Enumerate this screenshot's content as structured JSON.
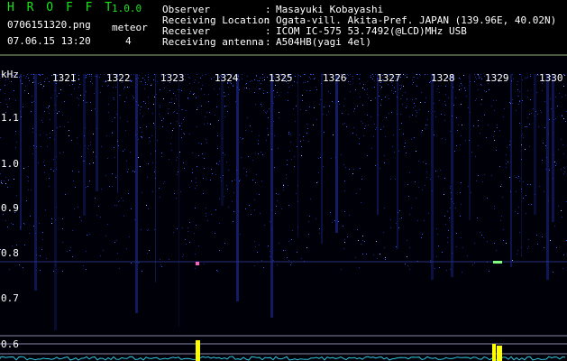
{
  "header": {
    "app_title": "H R O F F T",
    "version": "1.0.0",
    "filename": "0706151320.png",
    "datetime": "07.06.15 13:20",
    "meteor_label": "meteor",
    "meteor_count": "4"
  },
  "info": [
    {
      "label": "Observer",
      "value": "Masayuki Kobayashi"
    },
    {
      "label": "Receiving Location",
      "value": "Ogata-vill. Akita-Pref. JAPAN (139.96E, 40.02N)"
    },
    {
      "label": "Receiver",
      "value": "ICOM IC-575 53.7492(@LCD)MHz USB"
    },
    {
      "label": "Receiving antenna",
      "value": "A504HB(yagi 4el)"
    }
  ],
  "spectrogram": {
    "y_unit": "kHz",
    "y_ticks": [
      "1.1",
      "1.0",
      "0.9",
      "0.8",
      "0.7",
      "0.6"
    ],
    "time_ticks": [
      "1321",
      "1322",
      "1323",
      "1324",
      "1325",
      "1326",
      "1327",
      "1328",
      "1329",
      "1330"
    ]
  },
  "colors": {
    "header_green": "#19e619",
    "signal_blue": "#2a4fd8",
    "meteor_yellow": "#ffff00",
    "guide_line": "#8888aa"
  }
}
